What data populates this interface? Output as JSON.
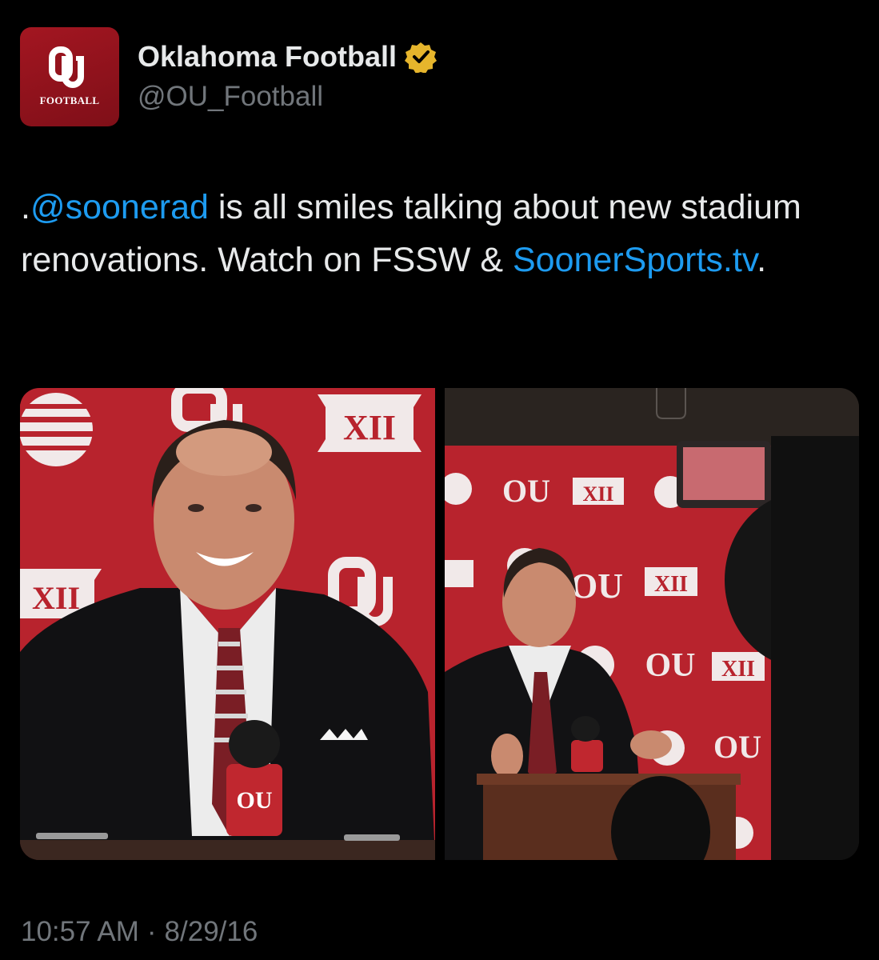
{
  "author": {
    "display_name": "Oklahoma Football",
    "handle": "@OU_Football",
    "avatar_text": "FOOTBALL",
    "verified_color": "#e6b52c"
  },
  "tweet": {
    "text_prefix": ".",
    "mention": "@soonerad",
    "text_middle": " is all smiles talking about new stadium renovations. Watch on FSSW & ",
    "link": "SoonerSports.tv",
    "text_suffix": "."
  },
  "media": {
    "photo_count": 2,
    "backdrop_color": "#b0202a",
    "backdrop_logos": [
      "OU",
      "XII",
      "AT&T globe"
    ]
  },
  "meta": {
    "time": "10:57 AM",
    "separator": "·",
    "date": "8/29/16"
  },
  "colors": {
    "link": "#1d9bf0",
    "text": "#e7e9ea",
    "secondary": "#71767b",
    "brand": "#8b111b"
  }
}
